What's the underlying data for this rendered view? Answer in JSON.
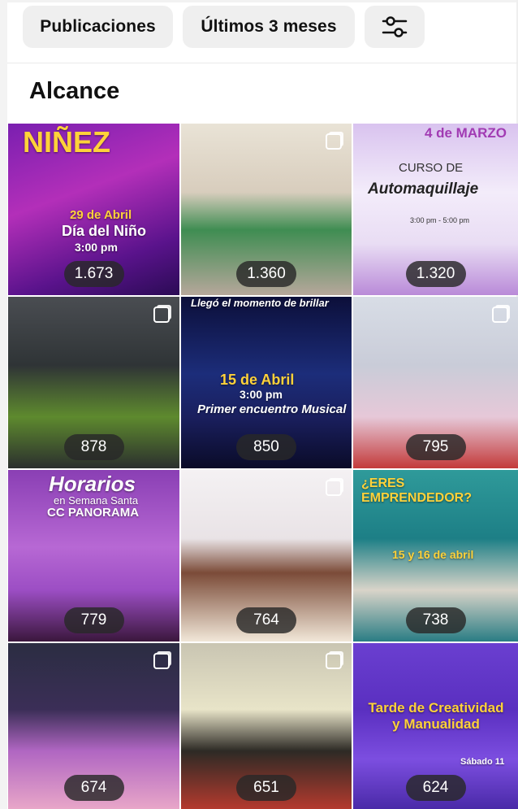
{
  "filters": {
    "content_type": "Publicaciones",
    "date_range": "Últimos 3 meses",
    "settings_icon": "sliders-icon"
  },
  "section_title": "Alcance",
  "posts": [
    {
      "value": "1.673",
      "texts": [
        "NIÑEZ",
        "29 de Abril",
        "Día del Niño",
        "3:00 pm"
      ]
    },
    {
      "value": "1.360",
      "texts": []
    },
    {
      "value": "1.320",
      "texts": [
        "4 de MARZO",
        "CURSO DE",
        "Automaquillaje",
        "3:00 pm - 5:00 pm"
      ]
    },
    {
      "value": "878",
      "texts": []
    },
    {
      "value": "850",
      "texts": [
        "Llegó el momento de brillar",
        "15 de Abril",
        "3:00 pm",
        "Primer encuentro Musical"
      ]
    },
    {
      "value": "795",
      "texts": []
    },
    {
      "value": "779",
      "texts": [
        "Horarios",
        "en Semana Santa",
        "CC PANORAMA"
      ]
    },
    {
      "value": "764",
      "texts": []
    },
    {
      "value": "738",
      "texts": [
        "¿ERES EMPRENDEDOR?",
        "15 y 16 de abril"
      ]
    },
    {
      "value": "674",
      "texts": []
    },
    {
      "value": "651",
      "texts": []
    },
    {
      "value": "624",
      "texts": [
        "Tarde de Creatividad y Manualidad",
        "Sábado 11"
      ]
    }
  ]
}
